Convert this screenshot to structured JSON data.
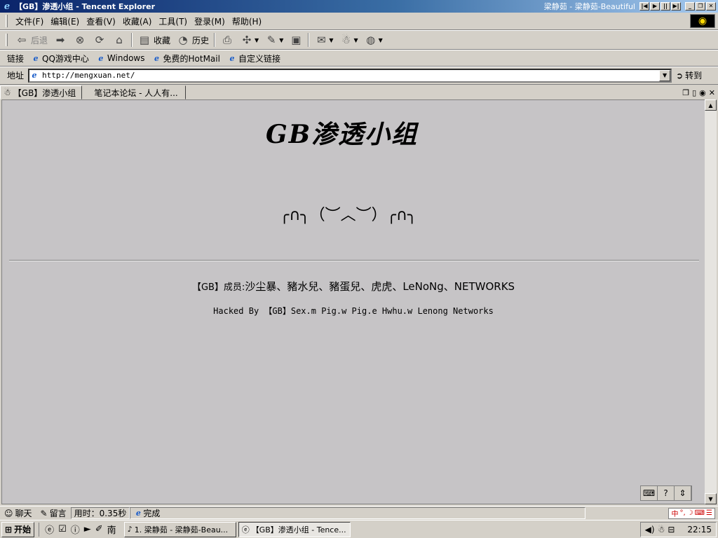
{
  "window": {
    "title": "【GB】渗透小组 - Tencent Explorer",
    "music": "梁静茹 - 梁静茹-Beautiful",
    "controls": [
      "|◀",
      "▶",
      "||",
      "▶|",
      "_",
      "❐",
      "✕"
    ]
  },
  "menu": [
    "文件(F)",
    "编辑(E)",
    "查看(V)",
    "收藏(A)",
    "工具(T)",
    "登录(M)",
    "帮助(H)"
  ],
  "toolbar": {
    "back": "后退",
    "favorites": "收藏",
    "history": "历史"
  },
  "links": {
    "label": "链接",
    "items": [
      "QQ游戏中心",
      "Windows",
      "免费的HotMail",
      "自定义链接"
    ]
  },
  "address": {
    "label": "地址",
    "url": "http://mengxuan.net/",
    "go": "转到"
  },
  "tabs": [
    "【GB】渗透小组",
    "笔记本论坛 - 人人有..."
  ],
  "page": {
    "logo": "GB渗透小组",
    "emoticons": "╭∩╮（︶︿︶）╭∩╮",
    "members_prefix": "【GB】成员:",
    "members_list": "沙尘暴、豬水兒、豬蛋兒、虎虎、LeNoNg、NETWORKS",
    "hacked": "Hacked By 【GB】Sex.m Pig.w Pig.e Hwhu.w Lenong Networks"
  },
  "status": {
    "chat": "聊天",
    "message": "留言",
    "time": "用时：0.35秒",
    "done": "完成"
  },
  "taskbar": {
    "start": "开始",
    "tasks": [
      "1. 梁静茹 - 梁静茹-Beau...",
      "【GB】渗透小组 - Tence..."
    ],
    "clock": "22:15"
  }
}
